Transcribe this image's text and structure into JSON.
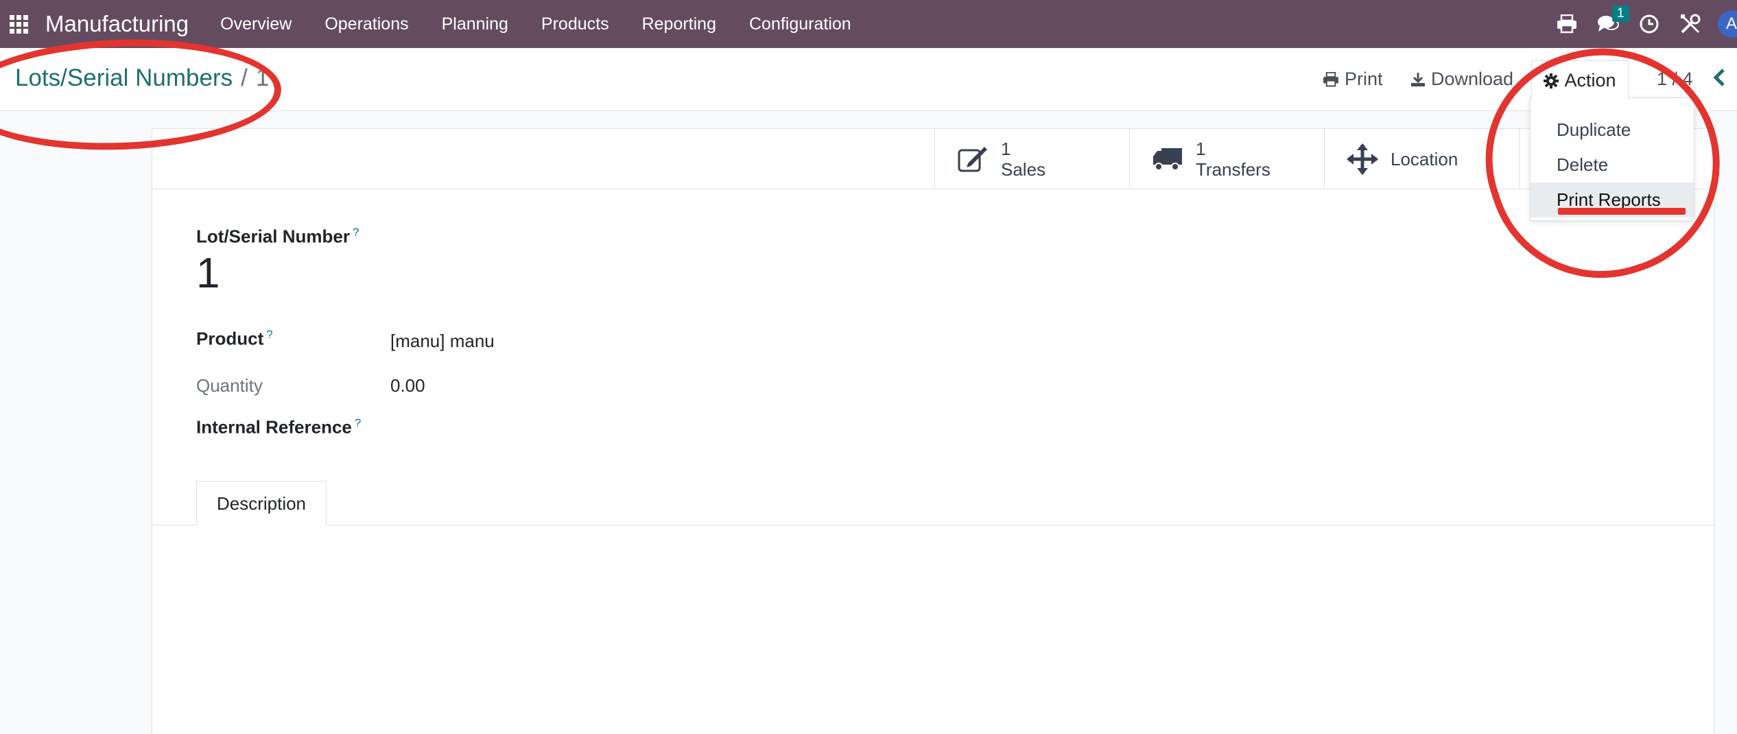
{
  "navbar": {
    "brand": "Manufacturing",
    "menu": [
      "Overview",
      "Operations",
      "Planning",
      "Products",
      "Reporting",
      "Configuration"
    ],
    "chat_badge": "1",
    "avatar_initial": "A",
    "icons": [
      "apps-icon",
      "print-icon",
      "chat-icon",
      "clock-icon",
      "tools-icon"
    ]
  },
  "control_panel": {
    "breadcrumb_parent": "Lots/Serial Numbers",
    "breadcrumb_separator": "/",
    "breadcrumb_current": "1",
    "print_label": "Print",
    "download_label": "Download",
    "action_label": "Action",
    "pager": "1 / 4"
  },
  "action_menu": {
    "items": [
      "Duplicate",
      "Delete",
      "Print Reports"
    ],
    "active": "Print Reports"
  },
  "smart_buttons": [
    {
      "value": "1",
      "label": "Sales",
      "icon": "edit-icon"
    },
    {
      "value": "1",
      "label": "Transfers",
      "icon": "truck-icon"
    },
    {
      "value": "",
      "label": "Location",
      "icon": "arrows-icon"
    }
  ],
  "form": {
    "lot_label": "Lot/Serial Number",
    "lot_value": "1",
    "help_mark": "?",
    "product_label": "Product",
    "product_value": "[manu] manu",
    "quantity_label": "Quantity",
    "quantity_value": "0.00",
    "internal_ref_label": "Internal Reference",
    "tab_description": "Description"
  },
  "colors": {
    "navbar": "#644b5f",
    "link": "#1f6e6f",
    "annotation": "#e3342f"
  }
}
